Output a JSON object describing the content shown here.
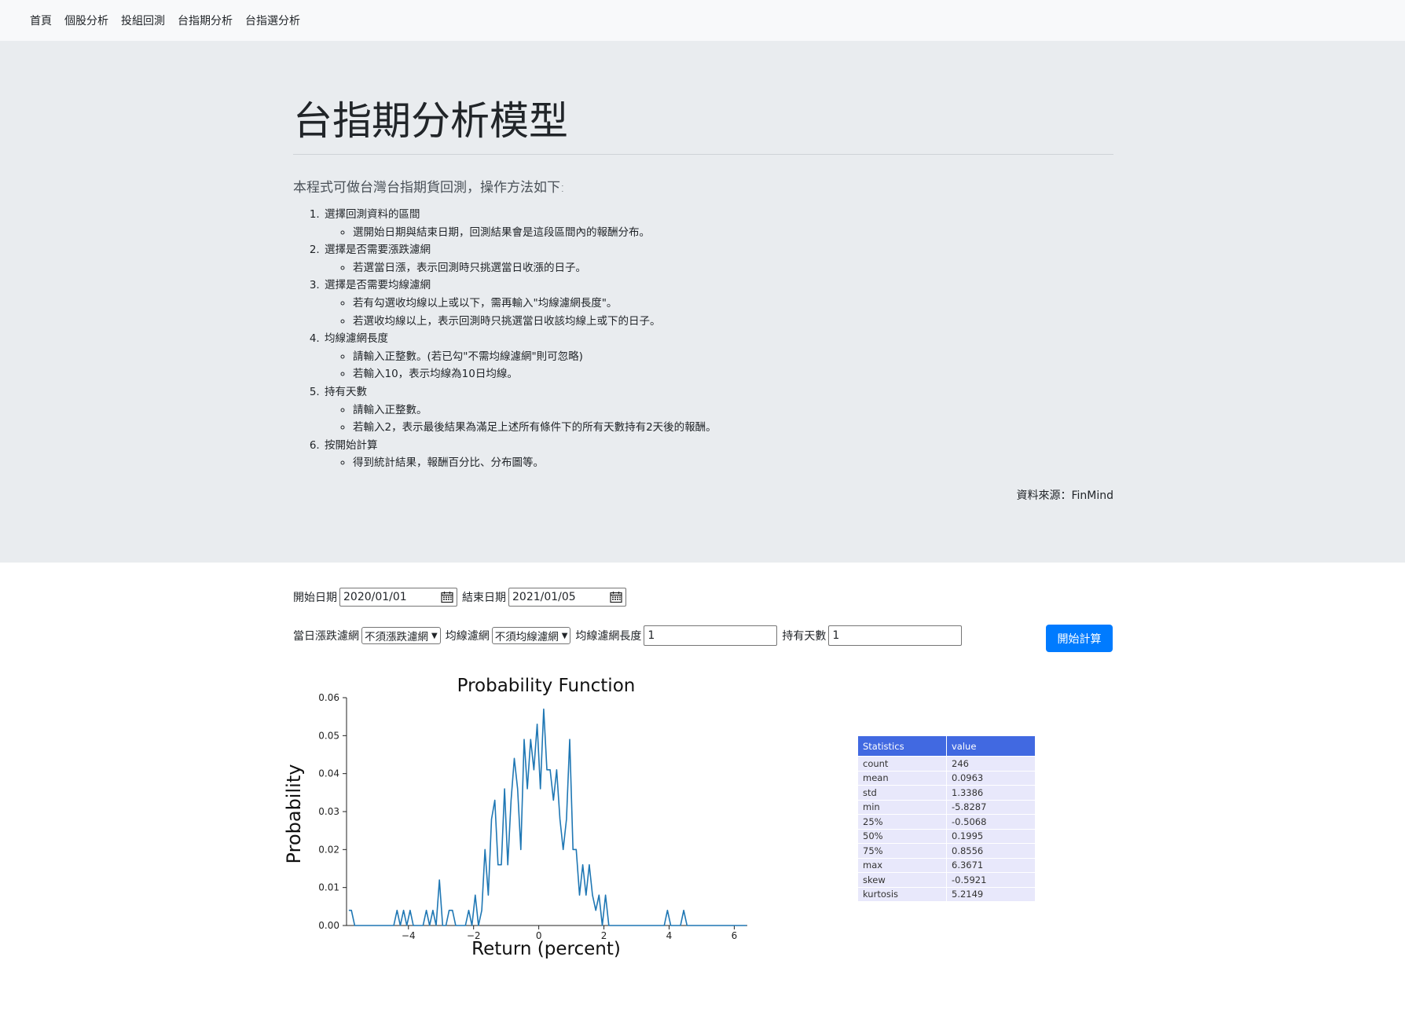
{
  "nav": {
    "items": [
      "首頁",
      "個股分析",
      "投組回測",
      "台指期分析",
      "台指選分析"
    ]
  },
  "hero": {
    "title": "台指期分析模型",
    "lead": "本程式可做台灣台指期貨回測，操作方法如下:",
    "steps": [
      {
        "label": "選擇回測資料的區間",
        "subs": [
          "選開始日期與結束日期，回測結果會是這段區間內的報酬分布。"
        ]
      },
      {
        "label": "選擇是否需要漲跌濾網",
        "subs": [
          "若選當日漲，表示回測時只挑選當日收漲的日子。"
        ]
      },
      {
        "label": "選擇是否需要均線濾網",
        "subs": [
          "若有勾選收均線以上或以下，需再輸入\"均線濾網長度\"。",
          "若選收均線以上，表示回測時只挑選當日收該均線上或下的日子。"
        ]
      },
      {
        "label": "均線濾網長度",
        "subs": [
          "請輸入正整數。(若已勾\"不需均線濾網\"則可忽略)",
          "若輸入10，表示均線為10日均線。"
        ]
      },
      {
        "label": "持有天數",
        "subs": [
          "請輸入正整數。",
          "若輸入2，表示最後結果為滿足上述所有條件下的所有天數持有2天後的報酬。"
        ]
      },
      {
        "label": "按開始計算",
        "subs": [
          "得到統計結果，報酬百分比、分布圖等。"
        ]
      }
    ],
    "source": "資料來源：FinMind"
  },
  "form": {
    "start_label": "開始日期",
    "start_value": "2020/01/01",
    "end_label": "結束日期",
    "end_value": "2021/01/05",
    "updown_label": "當日漲跌濾網",
    "updown_value": "不須漲跌濾網",
    "ma_label": "均線濾網",
    "ma_value": "不須均線濾網",
    "ma_len_label": "均線濾網長度",
    "ma_len_value": "1",
    "hold_label": "持有天數",
    "hold_value": "1",
    "submit_label": "開始計算"
  },
  "chart_data": {
    "type": "line",
    "title": "Probability Function",
    "xlabel": "Return (percent)",
    "ylabel": "Probability",
    "xlim": [
      -5.9,
      6.4
    ],
    "ylim": [
      0,
      0.06
    ],
    "xticks": [
      -4,
      -2,
      0,
      2,
      4,
      6
    ],
    "xtick_labels": [
      "−4",
      "−2",
      "0",
      "2",
      "4",
      "6"
    ],
    "yticks": [
      0,
      0.01,
      0.02,
      0.03,
      0.04,
      0.05,
      0.06
    ],
    "ytick_labels": [
      "0.00",
      "0.01",
      "0.02",
      "0.03",
      "0.04",
      "0.05",
      "0.06"
    ],
    "color": "#1f77b4",
    "series": [
      {
        "x": [
          -5.83,
          -5.75,
          -5.65,
          -5.55,
          -5.45,
          -5.35,
          -5.25,
          -5.15,
          -5.05,
          -4.95,
          -4.85,
          -4.75,
          -4.65,
          -4.55,
          -4.45,
          -4.35,
          -4.25,
          -4.15,
          -4.05,
          -3.95,
          -3.85,
          -3.75,
          -3.65,
          -3.55,
          -3.45,
          -3.35,
          -3.25,
          -3.15,
          -3.05,
          -2.95,
          -2.85,
          -2.75,
          -2.65,
          -2.55,
          -2.45,
          -2.35,
          -2.25,
          -2.15,
          -2.05,
          -1.95,
          -1.85,
          -1.75,
          -1.65,
          -1.55,
          -1.45,
          -1.35,
          -1.25,
          -1.15,
          -1.05,
          -0.95,
          -0.85,
          -0.75,
          -0.65,
          -0.55,
          -0.45,
          -0.35,
          -0.25,
          -0.15,
          -0.05,
          0.05,
          0.15,
          0.25,
          0.35,
          0.45,
          0.55,
          0.65,
          0.75,
          0.85,
          0.95,
          1.05,
          1.15,
          1.25,
          1.35,
          1.45,
          1.55,
          1.65,
          1.75,
          1.85,
          1.95,
          2.05,
          2.15,
          2.25,
          2.35,
          2.45,
          2.55,
          2.65,
          2.75,
          2.85,
          2.95,
          3.05,
          3.15,
          3.25,
          3.35,
          3.45,
          3.55,
          3.65,
          3.75,
          3.85,
          3.95,
          4.05,
          4.15,
          4.25,
          4.35,
          4.45,
          4.55,
          4.65,
          4.75,
          4.85,
          4.95,
          5.05,
          5.15,
          5.25,
          5.35,
          5.45,
          5.55,
          5.65,
          5.75,
          5.85,
          5.95,
          6.05,
          6.15,
          6.25,
          6.37
        ],
        "y": [
          0.004,
          0.004,
          0,
          0,
          0,
          0,
          0,
          0,
          0,
          0,
          0,
          0,
          0,
          0,
          0,
          0.004,
          0,
          0.004,
          0,
          0.004,
          0,
          0,
          0,
          0,
          0.004,
          0,
          0.004,
          0,
          0.012,
          0,
          0,
          0.004,
          0.004,
          0,
          0,
          0,
          0,
          0.004,
          0,
          0.008,
          0,
          0.004,
          0.02,
          0.008,
          0.028,
          0.033,
          0.016,
          0.016,
          0.036,
          0.016,
          0.033,
          0.044,
          0.036,
          0.02,
          0.049,
          0.036,
          0.049,
          0.041,
          0.053,
          0.036,
          0.057,
          0.041,
          0.041,
          0.033,
          0.041,
          0.028,
          0.02,
          0.028,
          0.049,
          0.02,
          0.02,
          0.008,
          0.016,
          0.008,
          0.016,
          0.008,
          0.004,
          0.008,
          0,
          0.008,
          0,
          0,
          0,
          0,
          0,
          0,
          0,
          0,
          0,
          0,
          0,
          0,
          0,
          0,
          0,
          0,
          0,
          0,
          0.004,
          0,
          0,
          0,
          0,
          0.004,
          0,
          0,
          0,
          0,
          0,
          0,
          0,
          0,
          0,
          0,
          0,
          0,
          0,
          0,
          0,
          0,
          0,
          0,
          0
        ]
      }
    ]
  },
  "stats": {
    "headers": [
      "Statistics",
      "value"
    ],
    "rows": [
      [
        "count",
        "246"
      ],
      [
        "mean",
        "0.0963"
      ],
      [
        "std",
        "1.3386"
      ],
      [
        "min",
        "-5.8287"
      ],
      [
        "25%",
        "-0.5068"
      ],
      [
        "50%",
        "0.1995"
      ],
      [
        "75%",
        "0.8556"
      ],
      [
        "max",
        "6.3671"
      ],
      [
        "skew",
        "-0.5921"
      ],
      [
        "kurtosis",
        "5.2149"
      ]
    ]
  }
}
